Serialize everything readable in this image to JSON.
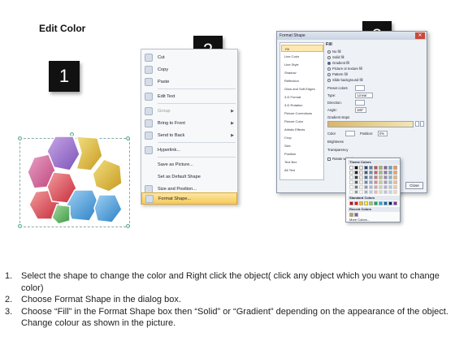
{
  "title": "Edit Color",
  "badges": [
    "1",
    "2",
    "3"
  ],
  "context_menu": {
    "items": [
      {
        "label": "Cut",
        "icon": "scissors-icon",
        "dim": false,
        "arrow": false
      },
      {
        "label": "Copy",
        "icon": "copy-icon",
        "dim": false,
        "arrow": false
      },
      {
        "label": "Paste",
        "icon": "paste-icon",
        "dim": false,
        "arrow": false
      },
      {
        "label": "Edit Text",
        "icon": "edit-text-icon",
        "dim": false,
        "arrow": false
      },
      {
        "label": "Group",
        "icon": "group-icon",
        "dim": true,
        "arrow": true
      },
      {
        "label": "Bring to Front",
        "icon": "bring-front-icon",
        "dim": false,
        "arrow": true
      },
      {
        "label": "Send to Back",
        "icon": "send-back-icon",
        "dim": false,
        "arrow": true
      },
      {
        "label": "Hyperlink...",
        "icon": "hyperlink-icon",
        "dim": false,
        "arrow": false
      },
      {
        "label": "Save as Picture...",
        "icon": "",
        "dim": false,
        "arrow": false
      },
      {
        "label": "Set as Default Shape",
        "icon": "",
        "dim": false,
        "arrow": false
      },
      {
        "label": "Size and Position...",
        "icon": "size-icon",
        "dim": false,
        "arrow": false
      },
      {
        "label": "Format Shape...",
        "icon": "format-shape-icon",
        "dim": false,
        "arrow": false,
        "highlight": true
      }
    ]
  },
  "dialog": {
    "title": "Format Shape",
    "close": "✕",
    "categories": [
      "Fill",
      "Line Color",
      "Line Style",
      "Shadow",
      "Reflection",
      "Glow and Soft Edges",
      "3-D Format",
      "3-D Rotation",
      "Picture Corrections",
      "Picture Color",
      "Artistic Effects",
      "Crop",
      "Size",
      "Position",
      "Text Box",
      "Alt Text"
    ],
    "section": "Fill",
    "fill_options": [
      "No fill",
      "Solid fill",
      "Gradient fill",
      "Picture or texture fill",
      "Pattern fill",
      "Slide background fill"
    ],
    "selected_fill": "Gradient fill",
    "fields": {
      "preset": "Preset colors:",
      "type_label": "Type:",
      "type_value": "Linear",
      "direction": "Direction:",
      "angle_label": "Angle:",
      "angle_value": "180°",
      "stops": "Gradient stops",
      "color_label": "Color",
      "position_label": "Position:",
      "position_value": "0%",
      "brightness": "Brightness",
      "transparency": "Transparency",
      "rotate": "Rotate with shape"
    },
    "close_button": "Close"
  },
  "color_popup": {
    "theme": "Theme Colors",
    "standard": "Standard Colors",
    "recent": "Recent Colors",
    "more": "More Colors..."
  },
  "instructions": [
    {
      "n": "1.",
      "text": "Select the shape to change the color and Right click the object( click any object which you want to change color)"
    },
    {
      "n": "2.",
      "text": "Choose Format Shape in the dialog box."
    },
    {
      "n": "3.",
      "text": "Choose “Fill” in the Format Shape box then “Solid” or “Gradient” depending on the appearance of the object. Change colour as shown in the picture."
    }
  ],
  "colors": {
    "accent": "#f5c95a",
    "badge": "#111111"
  }
}
